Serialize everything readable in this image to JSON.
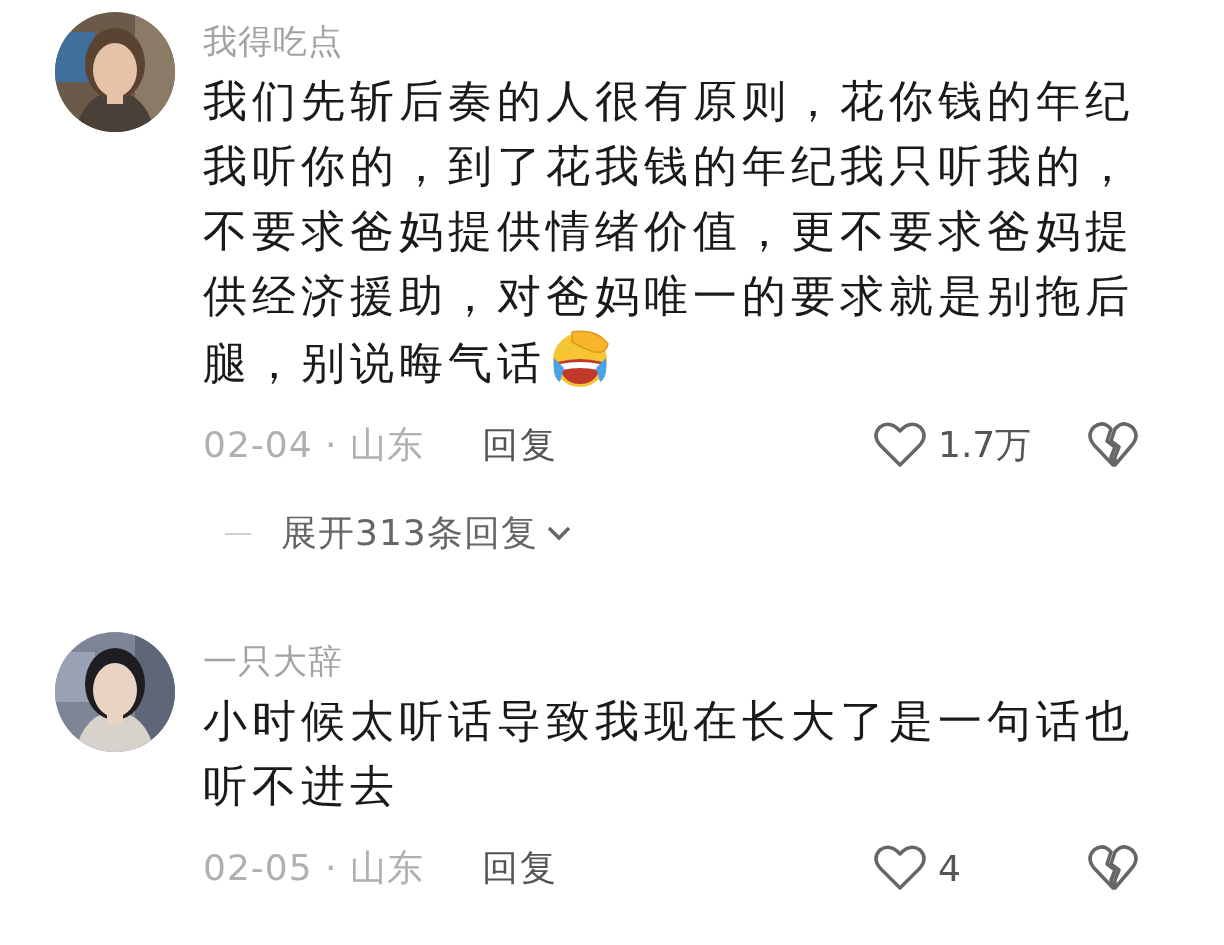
{
  "comments": [
    {
      "username": "我得吃点",
      "text": "我们先斩后奏的人很有原则，花你钱的年纪我听你的，到了花我钱的年纪我只听我的，不要求爸妈提供情绪价值，更不要求爸妈提供经济援助，对爸妈唯一的要求就是别拖后腿，别说晦气话",
      "trailing_emoji": true,
      "date_location": "02-04 · 山东",
      "reply": "回复",
      "likes": "1.7万",
      "expand": "展开313条回复"
    },
    {
      "username": "一只大辞",
      "text": "小时候太听话导致我现在长大了是一句话也听不进去",
      "trailing_emoji": false,
      "date_location": "02-05 · 山东",
      "reply": "回复",
      "likes": "4"
    }
  ]
}
